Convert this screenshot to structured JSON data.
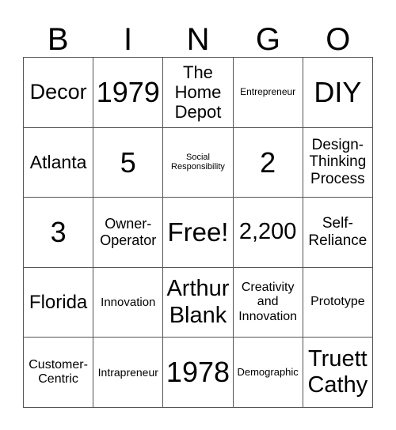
{
  "header": [
    "B",
    "I",
    "N",
    "G",
    "O"
  ],
  "cells": [
    [
      "Decor",
      "1979",
      "The Home Depot",
      "Entrepreneur",
      "DIY"
    ],
    [
      "Atlanta",
      "5",
      "Social Responsibility",
      "2",
      "Design-Thinking Process"
    ],
    [
      "3",
      "Owner-Operator",
      "Free!",
      "2,200",
      "Self-Reliance"
    ],
    [
      "Florida",
      "Innovation",
      "Arthur Blank",
      "Creativity and Innovation",
      "Prototype"
    ],
    [
      "Customer-Centric",
      "Intrapreneur",
      "1978",
      "Demographic",
      "Truett Cathy"
    ]
  ]
}
